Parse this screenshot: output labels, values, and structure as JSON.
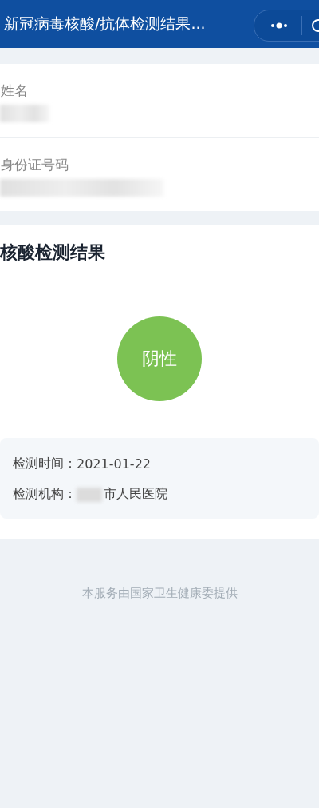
{
  "header": {
    "title": "新冠病毒核酸/抗体检测结果..."
  },
  "person": [
    {
      "label": "姓名",
      "redacted": true
    },
    {
      "label": "身份证号码",
      "redacted": true
    }
  ],
  "result_section": {
    "title": "核酸检测结果",
    "result": "阴性"
  },
  "details": [
    {
      "label": "检测时间：",
      "value": "2021-01-22",
      "redacted": false
    },
    {
      "label": "检测机构：",
      "value": "市人民医院",
      "redacted": true
    }
  ],
  "footer": "本服务由国家卫生健康委提供"
}
